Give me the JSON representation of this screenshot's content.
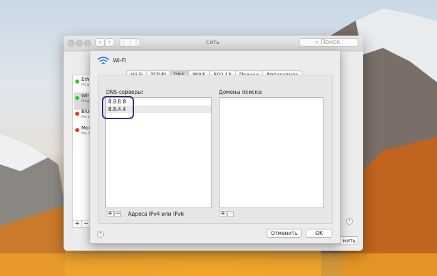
{
  "background_window": {
    "title": "Сеть",
    "search_placeholder": "Поиск",
    "services": [
      {
        "name": "Ethe",
        "status": "Под",
        "color": "#3fbf3f"
      },
      {
        "name": "Wi-",
        "status": "Под",
        "color": "#3fbf3f"
      },
      {
        "name": "Blue",
        "status": "Не с",
        "color": "#e03a3a"
      },
      {
        "name": "Mod",
        "status": "Не с",
        "color": "#e03a3a"
      }
    ],
    "add_label": "+",
    "remove_label": "−",
    "apply_label": "нить",
    "help_label": "?"
  },
  "sheet": {
    "title": "Wi-Fi",
    "tabs": [
      {
        "label": "Wi-Fi",
        "active": false
      },
      {
        "label": "TCP/IP",
        "active": false
      },
      {
        "label": "DNS",
        "active": true
      },
      {
        "label": "WINS",
        "active": false
      },
      {
        "label": "802.1X",
        "active": false
      },
      {
        "label": "Прокси",
        "active": false
      },
      {
        "label": "Аппаратура",
        "active": false
      }
    ],
    "dns_label": "DNS-серверы:",
    "dns_servers": [
      "8.8.8.8",
      "8.8.4.4"
    ],
    "search_domains_label": "Домены поиска:",
    "add_label": "+",
    "remove_label": "−",
    "hint": "Адреса IPv4 или IPv6",
    "cancel_label": "Отменить",
    "ok_label": "OK",
    "help_label": "?"
  },
  "colors": {
    "highlight_ring": "#3b2a7a",
    "wifi_icon": "#1e7bd8"
  }
}
